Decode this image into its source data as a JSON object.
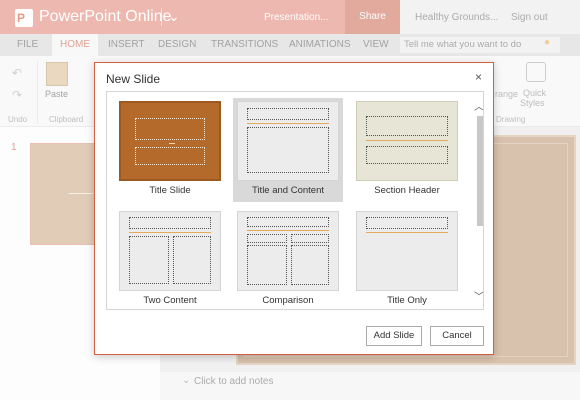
{
  "app": {
    "title": "PowerPoint Online",
    "logo_letter": "P",
    "document_name": "Presentation...",
    "share_label": "Share",
    "user_name": "Healthy Grounds...",
    "sign_out_label": "Sign out",
    "accent_color": "#dc7f6d"
  },
  "ribbon_tabs": [
    "FILE",
    "HOME",
    "INSERT",
    "DESIGN",
    "TRANSITIONS",
    "ANIMATIONS",
    "VIEW"
  ],
  "active_tab": "HOME",
  "tell_me_placeholder": "Tell me what you want to do",
  "ribbon": {
    "paste_label": "Paste",
    "undo_group": "Undo",
    "clipboard_group": "Clipboard",
    "drawing_group": "Drawing",
    "arrange_label": "range",
    "quick_styles_label_1": "Quick",
    "quick_styles_label_2": "Styles"
  },
  "slides_panel": {
    "slide_number": "1"
  },
  "notes_placeholder": "Click to add notes",
  "dialog": {
    "title": "New Slide",
    "close_glyph": "×",
    "layouts": [
      "Title Slide",
      "Title and Content",
      "Section Header",
      "Two Content",
      "Comparison",
      "Title Only"
    ],
    "selected_layout": "Title and Content",
    "add_button": "Add Slide",
    "cancel_button": "Cancel"
  }
}
